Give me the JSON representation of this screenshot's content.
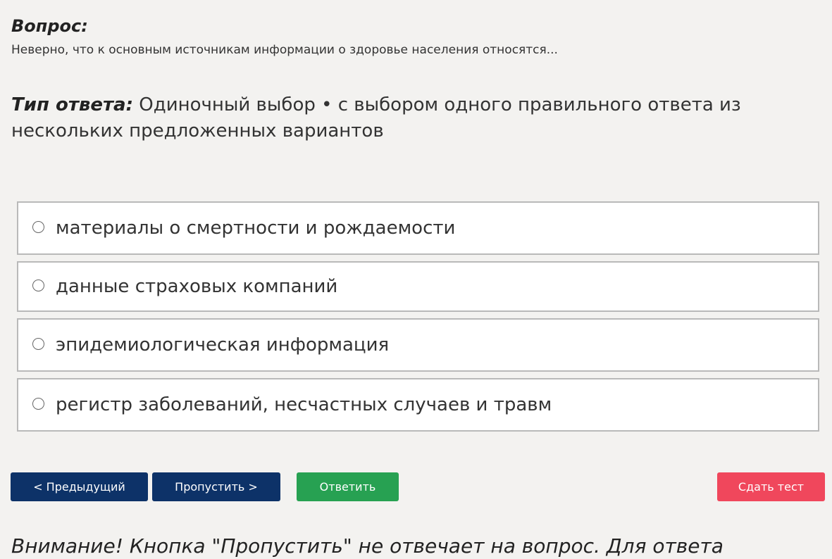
{
  "question": {
    "label": "Вопрос:",
    "text": "Неверно, что к основным источникам информации о здоровье населения относятся..."
  },
  "answer_type": {
    "label": "Тип ответа:",
    "value": "Одиночный выбор • с выбором одного правильного ответа из нескольких предложенных вариантов"
  },
  "options": [
    {
      "label": "материалы о смертности и рождаемости",
      "selected": false
    },
    {
      "label": "данные страховых компаний",
      "selected": false
    },
    {
      "label": "эпидемиологическая информация",
      "selected": false
    },
    {
      "label": "регистр заболеваний, несчастных случаев и травм",
      "selected": false
    }
  ],
  "buttons": {
    "prev": "< Предыдущий",
    "skip": "Пропустить >",
    "answer": "Ответить",
    "submit": "Сдать тест"
  },
  "footer": {
    "note": "Внимание! Кнопка \"Пропустить\" не отвечает на вопрос. Для ответа"
  },
  "colors": {
    "nav_button": "#0d3268",
    "answer_button": "#27a152",
    "submit_button": "#f0475c",
    "background": "#f3f2f0"
  }
}
